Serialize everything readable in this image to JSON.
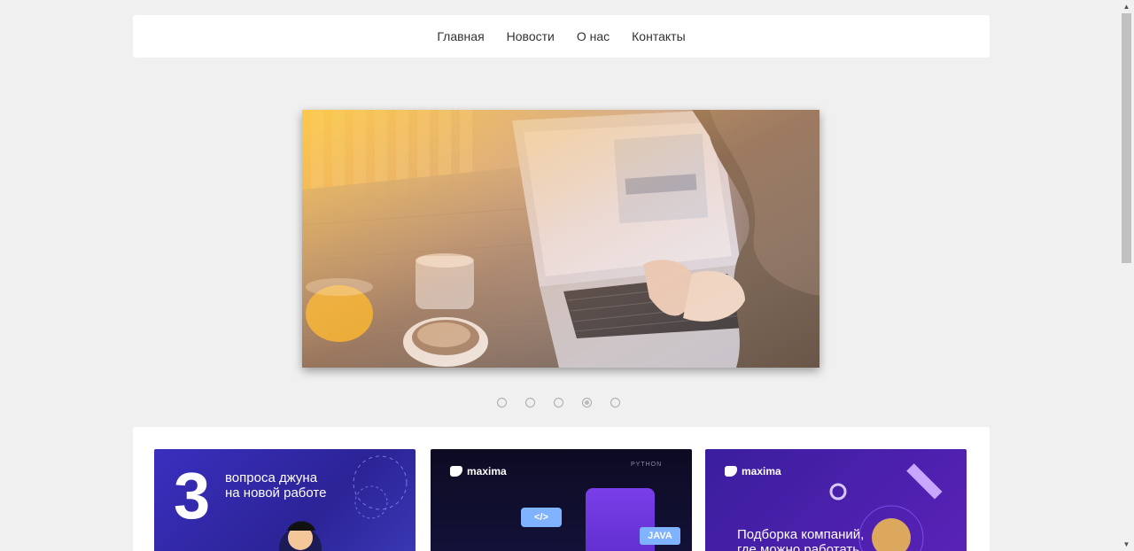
{
  "nav": {
    "items": [
      {
        "label": "Главная"
      },
      {
        "label": "Новости"
      },
      {
        "label": "О нас"
      },
      {
        "label": "Контакты"
      }
    ]
  },
  "slider": {
    "image": "laptop-on-cafe-table-photo",
    "slide_count": 5,
    "active_index": 3
  },
  "cards": [
    {
      "number": "3",
      "title_line1": "вопроса джуна",
      "title_line2": "на новой работе"
    },
    {
      "logo": "maxima",
      "tag": "PYTHON",
      "badge1": "</>",
      "badge2": "JAVA"
    },
    {
      "logo": "maxima",
      "title_line1": "Подборка компаний,",
      "title_line2": "где можно работать"
    }
  ],
  "colors": {
    "page_bg": "#f0f0f0",
    "nav_text": "#333333",
    "card_accent": "#7fb2ff"
  }
}
